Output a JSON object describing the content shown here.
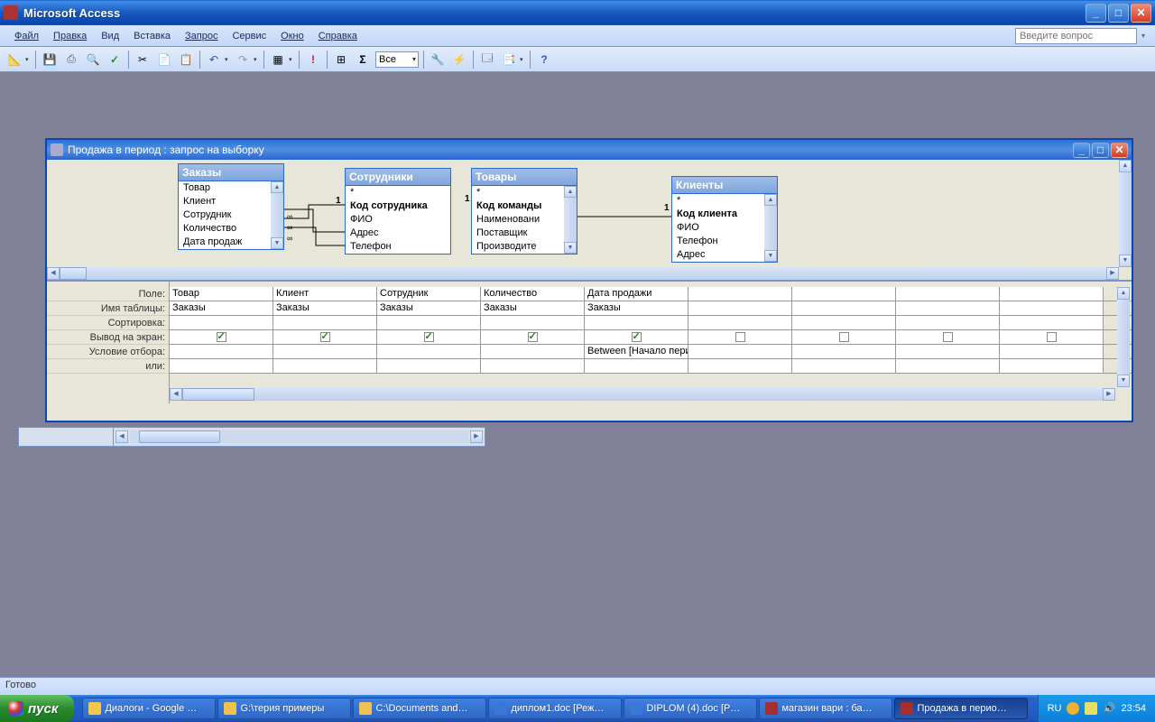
{
  "app": {
    "title": "Microsoft Access"
  },
  "menu": {
    "items": [
      "Файл",
      "Правка",
      "Вид",
      "Вставка",
      "Запрос",
      "Сервис",
      "Окно",
      "Справка"
    ],
    "ask_placeholder": "Введите вопрос"
  },
  "toolbar": {
    "combo_value": "Все"
  },
  "query_window": {
    "title": "Продажа в период : запрос на выборку",
    "tables": {
      "orders": {
        "caption": "Заказы",
        "fields": [
          "Товар",
          "Клиент",
          "Сотрудник",
          "Количество",
          "Дата продаж"
        ]
      },
      "employees": {
        "caption": "Сотрудники",
        "fields": [
          "*",
          "Код сотрудника",
          "ФИО",
          "Адрес",
          "Телефон"
        ],
        "bold_index": 1
      },
      "goods": {
        "caption": "Товары",
        "fields": [
          "*",
          "Код команды",
          "Наименовани",
          "Поставщик",
          "Производите"
        ],
        "bold_index": 1
      },
      "clients": {
        "caption": "Клиенты",
        "fields": [
          "*",
          "Код клиента",
          "ФИО",
          "Телефон",
          "Адрес"
        ],
        "bold_index": 1
      }
    },
    "qbe": {
      "labels": [
        "Поле:",
        "Имя таблицы:",
        "Сортировка:",
        "Вывод на экран:",
        "Условие отбора:",
        "или:"
      ],
      "columns": [
        {
          "field": "Товар",
          "table": "Заказы",
          "sort": "",
          "show": true,
          "criteria": "",
          "or": ""
        },
        {
          "field": "Клиент",
          "table": "Заказы",
          "sort": "",
          "show": true,
          "criteria": "",
          "or": ""
        },
        {
          "field": "Сотрудник",
          "table": "Заказы",
          "sort": "",
          "show": true,
          "criteria": "",
          "or": ""
        },
        {
          "field": "Количество",
          "table": "Заказы",
          "sort": "",
          "show": true,
          "criteria": "",
          "or": ""
        },
        {
          "field": "Дата продажи",
          "table": "Заказы",
          "sort": "",
          "show": true,
          "criteria": "Between [Начало пери",
          "or": ""
        },
        {
          "field": "",
          "table": "",
          "sort": "",
          "show": false,
          "criteria": "",
          "or": ""
        },
        {
          "field": "",
          "table": "",
          "sort": "",
          "show": false,
          "criteria": "",
          "or": ""
        },
        {
          "field": "",
          "table": "",
          "sort": "",
          "show": false,
          "criteria": "",
          "or": ""
        },
        {
          "field": "",
          "table": "",
          "sort": "",
          "show": false,
          "criteria": "",
          "or": ""
        }
      ]
    }
  },
  "statusbar": {
    "text": "Готово"
  },
  "taskbar": {
    "start": "пуск",
    "items": [
      {
        "label": "Диалоги - Google …",
        "icon": "#f4c94a"
      },
      {
        "label": "G:\\терия примеры",
        "icon": "#f0c050"
      },
      {
        "label": "C:\\Documents and…",
        "icon": "#f0c050"
      },
      {
        "label": "диплом1.doc [Реж…",
        "icon": "#3a78d8"
      },
      {
        "label": "DIPLOM (4).doc [P…",
        "icon": "#3a78d8"
      },
      {
        "label": "магазин вари : ба…",
        "icon": "#a33030"
      },
      {
        "label": "Продажа в перио…",
        "icon": "#a33030",
        "active": true
      }
    ],
    "lang": "RU",
    "time": "23:54"
  }
}
